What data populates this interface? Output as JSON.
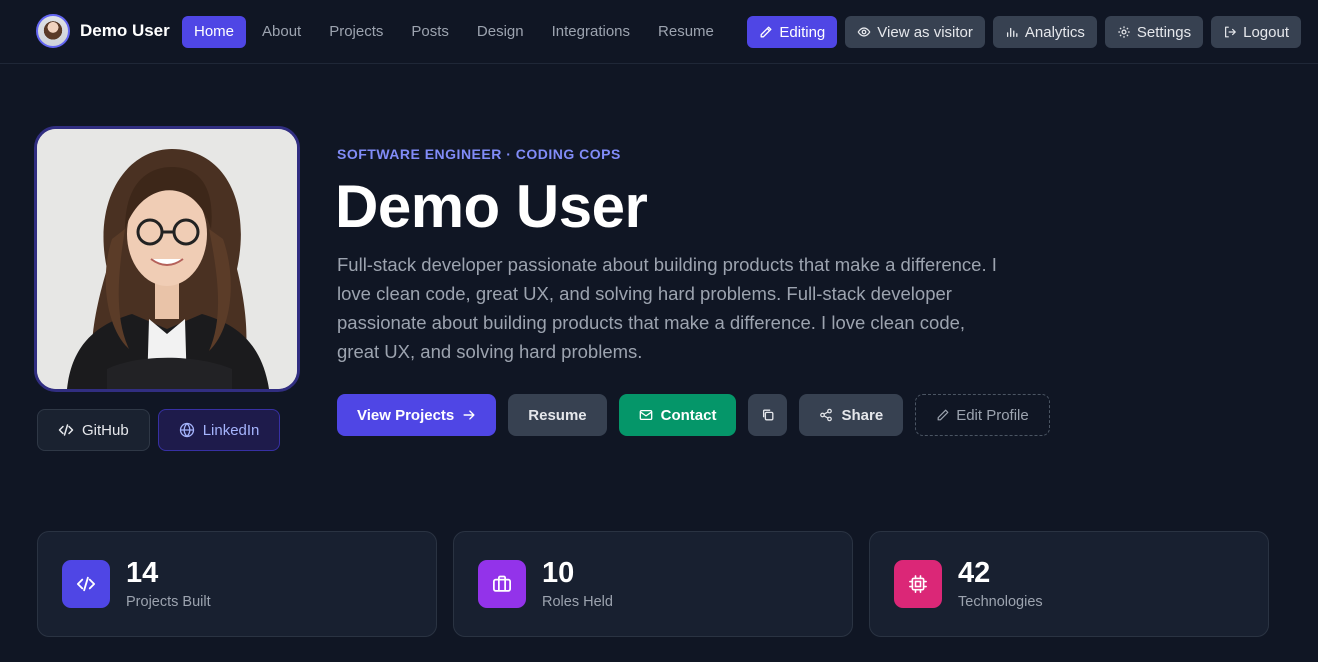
{
  "colors": {
    "background": "#101624",
    "accent": "#4f46e5",
    "contact_green": "#059669",
    "projects_icon": "#4f46e5",
    "roles_icon": "#9333ea",
    "tech_icon": "#db2777"
  },
  "nav": {
    "brand_name": "Demo User",
    "links": [
      {
        "label": "Home",
        "active": true
      },
      {
        "label": "About"
      },
      {
        "label": "Projects"
      },
      {
        "label": "Posts"
      },
      {
        "label": "Design"
      },
      {
        "label": "Integrations"
      },
      {
        "label": "Resume"
      }
    ],
    "actions": {
      "editing": {
        "label": "Editing",
        "icon": "pencil-icon"
      },
      "view_as_visitor": {
        "label": "View as visitor",
        "icon": "eye-icon"
      },
      "analytics": {
        "label": "Analytics",
        "icon": "bar-chart-icon"
      },
      "settings": {
        "label": "Settings",
        "icon": "gear-icon"
      },
      "logout": {
        "label": "Logout",
        "icon": "logout-icon"
      }
    }
  },
  "hero": {
    "eyebrow": "SOFTWARE ENGINEER · CODING COPS",
    "name": "Demo User",
    "bio": "Full-stack developer passionate about building products that make a difference. I love clean code, great UX, and solving hard problems. Full-stack developer passionate about building products that make a difference. I love clean code, great UX, and solving hard problems.",
    "social": {
      "github": {
        "label": "GitHub",
        "icon": "code-icon"
      },
      "linkedin": {
        "label": "LinkedIn",
        "icon": "globe-icon"
      }
    },
    "buttons": {
      "view_projects": {
        "label": "View Projects",
        "icon": "arrow-right-icon"
      },
      "resume": {
        "label": "Resume"
      },
      "contact": {
        "label": "Contact",
        "icon": "mail-icon"
      },
      "copy": {
        "icon": "copy-icon"
      },
      "share": {
        "label": "Share",
        "icon": "share-icon"
      },
      "edit_profile": {
        "label": "Edit Profile",
        "icon": "pencil-icon"
      }
    }
  },
  "stats": [
    {
      "value": "14",
      "label": "Projects Built",
      "icon": "code-icon"
    },
    {
      "value": "10",
      "label": "Roles Held",
      "icon": "briefcase-icon"
    },
    {
      "value": "42",
      "label": "Technologies",
      "icon": "chip-icon"
    }
  ]
}
